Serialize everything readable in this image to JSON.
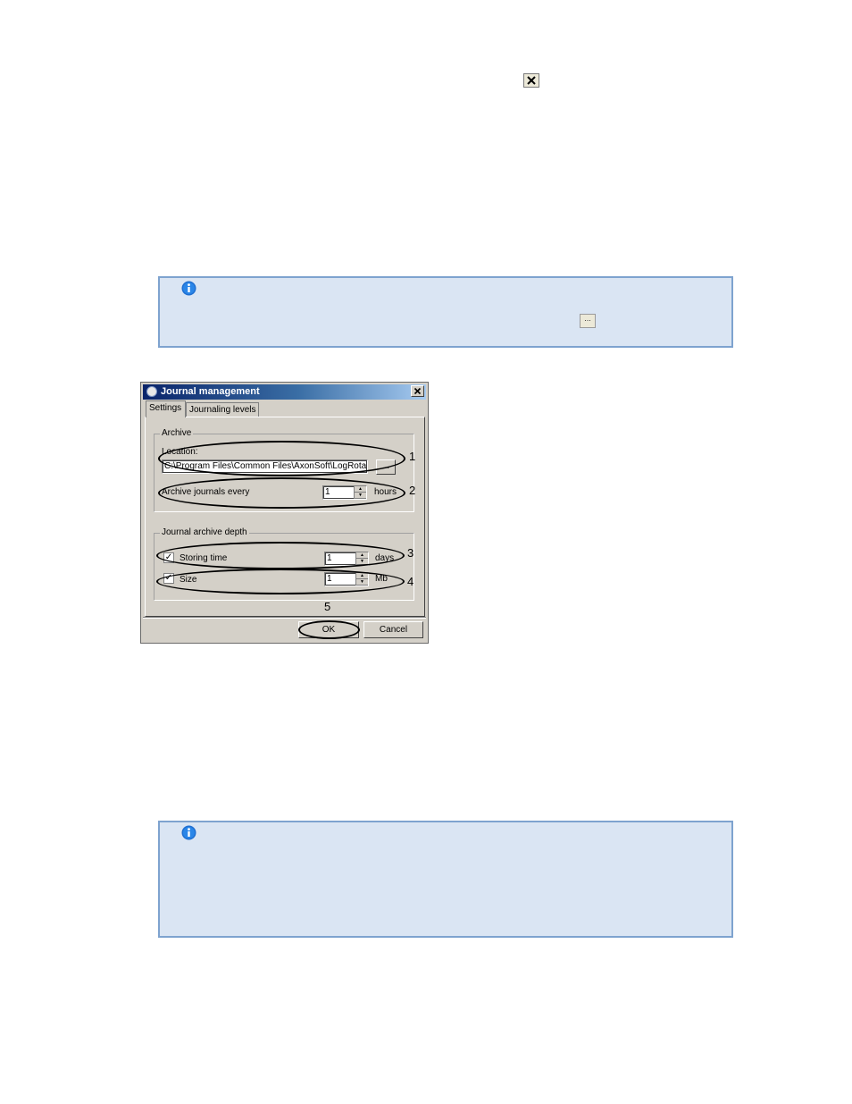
{
  "dialog": {
    "title": "Journal management",
    "tabs": [
      {
        "label": "Settings",
        "active": true
      },
      {
        "label": "Journaling levels",
        "active": false
      }
    ],
    "archive": {
      "legend": "Archive",
      "location_label": "Location:",
      "location_value": "C:\\Program Files\\Common Files\\AxonSoft\\LogRotate",
      "browse_label": "...",
      "archive_every_label": "Archive journals every",
      "archive_every_value": "1",
      "archive_every_unit": "hours"
    },
    "depth": {
      "legend": "Journal archive depth",
      "storing_time_label": "Storing time",
      "storing_time_checked": true,
      "storing_time_value": "1",
      "storing_time_unit": "days",
      "size_label": "Size",
      "size_checked": true,
      "size_value": "1",
      "size_unit": "Mb"
    },
    "ok_label": "OK",
    "cancel_label": "Cancel"
  },
  "callouts": [
    "1",
    "2",
    "3",
    "4",
    "5"
  ],
  "notes": [
    {
      "icon": "info-icon",
      "button_label": "..."
    },
    {
      "icon": "info-icon"
    }
  ],
  "colors": {
    "note_bg": "#dae5f3",
    "note_border": "#7ea3cf",
    "title_gradient_start": "#0a246a",
    "dialog_bg": "#d4d0c8"
  }
}
